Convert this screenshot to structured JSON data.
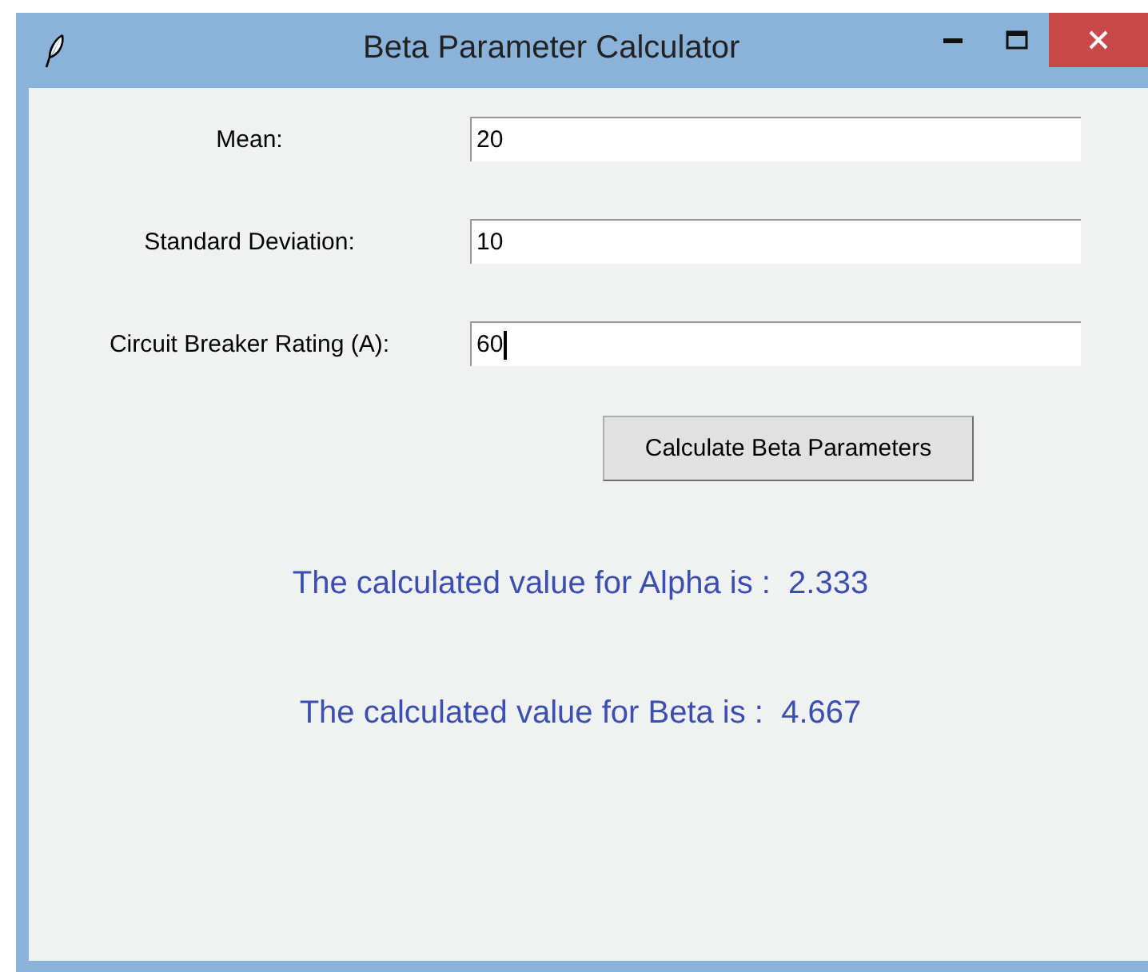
{
  "window": {
    "title": "Beta Parameter Calculator"
  },
  "fields": [
    {
      "label": "Mean:",
      "value": "20",
      "focused": false
    },
    {
      "label": "Standard Deviation:",
      "value": "10",
      "focused": false
    },
    {
      "label": "Circuit Breaker Rating (A):",
      "value": "60",
      "focused": true
    }
  ],
  "button": "Calculate Beta Parameters",
  "results": [
    "The calculated value for Alpha is :  2.333",
    "The calculated value for Beta is :  4.667"
  ]
}
